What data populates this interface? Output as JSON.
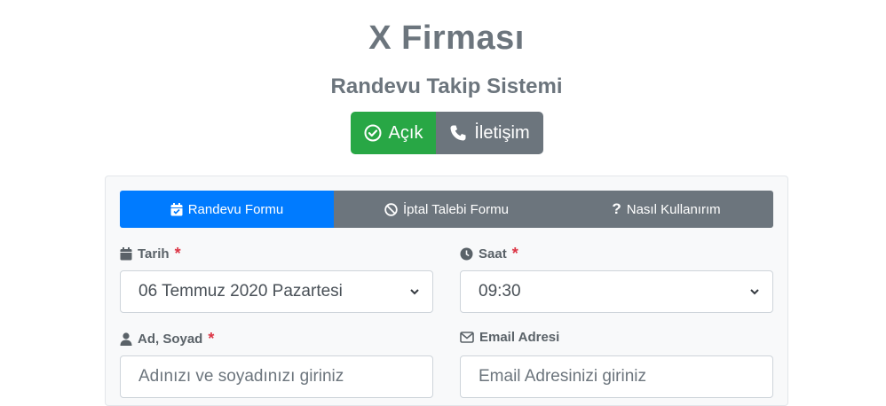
{
  "header": {
    "title": "X Firması",
    "subtitle": "Randevu Takip Sistemi"
  },
  "status_buttons": {
    "open_label": "Açık",
    "contact_label": "İletişim"
  },
  "tabs": [
    {
      "label": "Randevu Formu",
      "active": true
    },
    {
      "label": "İptal Talebi Formu",
      "active": false
    },
    {
      "label": "Nasıl Kullanırım",
      "active": false
    }
  ],
  "form": {
    "date": {
      "label": "Tarih",
      "required_mark": "*",
      "value": "06 Temmuz 2020 Pazartesi"
    },
    "time": {
      "label": "Saat",
      "required_mark": "*",
      "value": "09:30"
    },
    "name": {
      "label": "Ad, Soyad",
      "required_mark": "*",
      "placeholder": "Adınızı ve soyadınızı giriniz"
    },
    "email": {
      "label": "Email Adresi",
      "placeholder": "Email Adresinizi giriniz"
    }
  },
  "colors": {
    "primary": "#007bff",
    "success": "#28a745",
    "secondary": "#6c757d",
    "danger": "#dc3545"
  }
}
